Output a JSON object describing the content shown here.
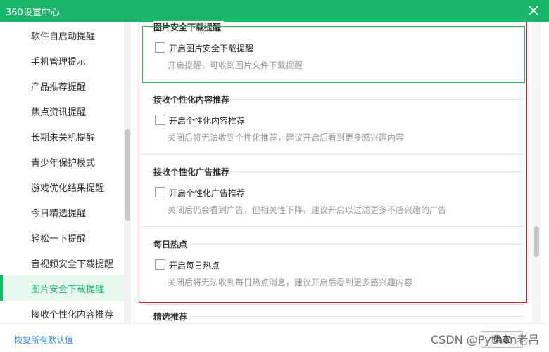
{
  "window": {
    "title": "360设置中心"
  },
  "sidebar": {
    "items": [
      {
        "label": "软件自启动提醒"
      },
      {
        "label": "手机管理提示"
      },
      {
        "label": "产品推荐提醒"
      },
      {
        "label": "焦点资讯提醒"
      },
      {
        "label": "长期未关机提醒"
      },
      {
        "label": "青少年保护模式"
      },
      {
        "label": "游戏优化结果提醒"
      },
      {
        "label": "今日精选提醒"
      },
      {
        "label": "轻松一下提醒"
      },
      {
        "label": "音视频安全下载提醒"
      },
      {
        "label": "图片安全下载提醒",
        "active": true
      },
      {
        "label": "接收个性化内容推荐"
      }
    ]
  },
  "sections": [
    {
      "title": "图片安全下载提醒",
      "option": "开启图片安全下载提醒",
      "description": "开启提醒，可收到图片文件下载提醒",
      "checked": false
    },
    {
      "title": "接收个性化内容推荐",
      "option": "开启个性化内容推荐",
      "description": "关闭后将无法收到个性化推荐，建议开启后看到更多感兴趣内容",
      "checked": false
    },
    {
      "title": "接收个性化广告推荐",
      "option": "开启个性化广告推荐",
      "description": "关闭后仍会看到广告，但相关性下降，建议开启以过滤更多不感兴趣的广告",
      "checked": false
    },
    {
      "title": "每日热点",
      "option": "开启每日热点",
      "description": "关闭后将无法收到每日热点消息，建议开启后看到更多感兴趣内容",
      "checked": false
    },
    {
      "title": "精选推荐"
    }
  ],
  "footer": {
    "restore_label": "恢复所有默认值",
    "confirm_label": "确定"
  },
  "watermark": "CSDN @Python老吕",
  "colors": {
    "brand": "#18b56a",
    "highlight_green": "#2fb55b",
    "highlight_red": "#d9232f",
    "link": "#2a7fd4"
  }
}
